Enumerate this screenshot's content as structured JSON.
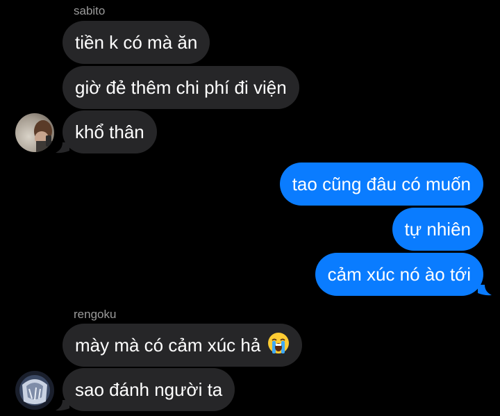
{
  "conversation": {
    "groups": [
      {
        "sender": "sabito",
        "messages": [
          "tiền k có mà ăn",
          "giờ đẻ thêm chi phí đi viện",
          "khổ thân"
        ]
      },
      {
        "sender": "",
        "messages": [
          "tao cũng đâu có muốn",
          "tự nhiên",
          "cảm xúc nó ào tới"
        ]
      },
      {
        "sender": "rengoku",
        "messages": [
          "mày mà có cảm xúc hả",
          "sao đánh người ta"
        ]
      }
    ],
    "emoji": "loudly-crying-face-icon"
  },
  "colors": {
    "background": "#000000",
    "incoming_bubble": "#262628",
    "outgoing_bubble": "#0a7cff",
    "sender_label": "#9b9b9b"
  }
}
